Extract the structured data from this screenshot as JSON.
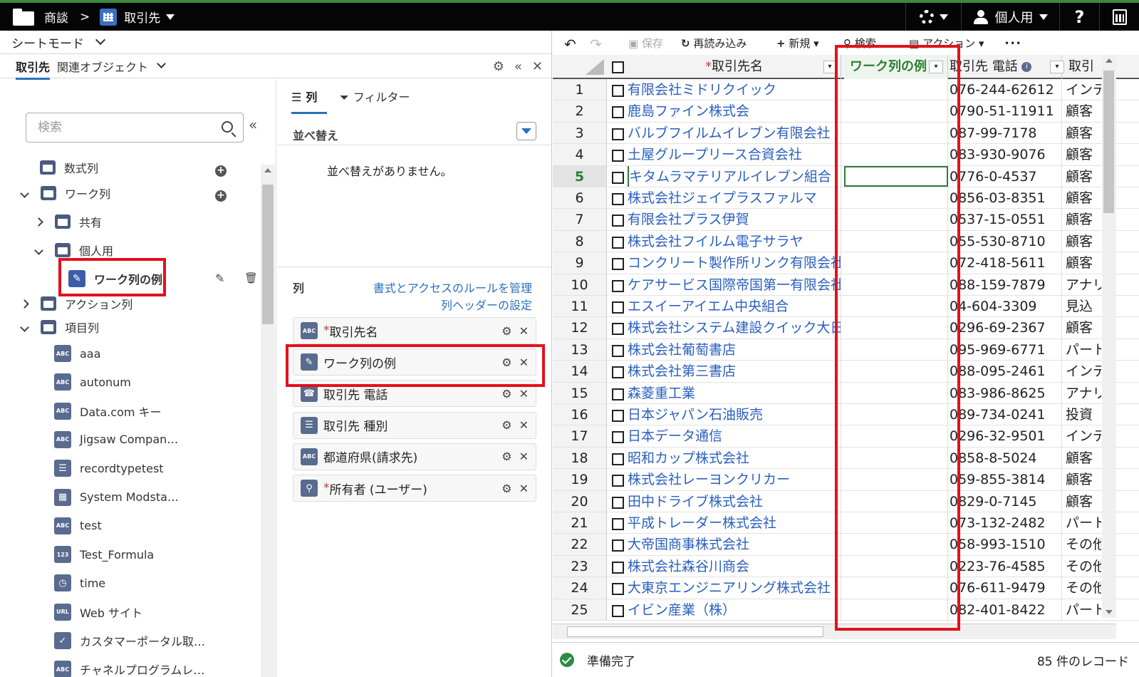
{
  "topbar": {
    "breadcrumb_parent": "商談",
    "separator": ">",
    "current": "取引先",
    "user_view": "個人用",
    "help": "?"
  },
  "left": {
    "sheet_mode": "シートモード",
    "tab_active": "取引先",
    "tab_related": "関連オブジェクト",
    "search_placeholder": "検索",
    "tree": [
      {
        "label": "数式列"
      },
      {
        "label": "ワーク列"
      },
      {
        "label": "共有"
      },
      {
        "label": "個人用"
      },
      {
        "label": "ワーク列の例"
      },
      {
        "label": "アクション列"
      },
      {
        "label": "項目列"
      }
    ],
    "fields": [
      {
        "label": "aaa",
        "icon": "ABC"
      },
      {
        "label": "autonum",
        "icon": "ABC"
      },
      {
        "label": "Data.com キー",
        "icon": "ABC"
      },
      {
        "label": "Jigsaw Compan…",
        "icon": "ABC"
      },
      {
        "label": "recordtypetest",
        "icon": "☰"
      },
      {
        "label": "System Modsta…",
        "icon": "▦"
      },
      {
        "label": "test",
        "icon": "ABC"
      },
      {
        "label": "Test_Formula",
        "icon": "123"
      },
      {
        "label": "time",
        "icon": "◷"
      },
      {
        "label": "Web サイト",
        "icon": "URL"
      },
      {
        "label": "カスタマーポータル取…",
        "icon": "✓"
      },
      {
        "label": "チャネルプログラムレ…",
        "icon": "ABC"
      }
    ]
  },
  "middle": {
    "tab_columns": "列",
    "tab_filter": "フィルター",
    "sort_title": "並べ替え",
    "sort_empty": "並べ替えがありません。",
    "columns_title": "列",
    "link_rules": "書式とアクセスのルールを管理",
    "link_header": "列ヘッダーの設定",
    "columns": [
      {
        "label": "取引先名",
        "required": "*",
        "icon": "ABC"
      },
      {
        "label": "ワーク列の例",
        "required": "",
        "icon": "✎"
      },
      {
        "label": "取引先 電話",
        "required": "",
        "icon": "☎"
      },
      {
        "label": "取引先 種別",
        "required": "",
        "icon": "☰"
      },
      {
        "label": "都道府県(請求先)",
        "required": "",
        "icon": "ABC"
      },
      {
        "label": "所有者 (ユーザー)",
        "required": "*",
        "icon": "⚲"
      }
    ]
  },
  "toolbar": {
    "save": "保存",
    "reload": "再読み込み",
    "new": "新規",
    "search": "検索",
    "action": "アクション",
    "more": "•••"
  },
  "grid": {
    "headers": {
      "name": "取引先名",
      "name_req": "*",
      "work": "ワーク列の例",
      "phone": "取引先 電話",
      "type": "取引"
    },
    "selected_row": 5,
    "rows": [
      {
        "n": "1",
        "name": "有限会社ミドリクイック",
        "phone": "076-244-62612",
        "type": "インテ"
      },
      {
        "n": "2",
        "name": "鹿島ファイン株式会",
        "phone": "0790-51-11911",
        "type": "顧客"
      },
      {
        "n": "3",
        "name": "バルブフイルムイレブン有限会社",
        "phone": "087-99-7178",
        "type": "顧客"
      },
      {
        "n": "4",
        "name": "土屋グループリース合資会社",
        "phone": "083-930-9076",
        "type": "顧客"
      },
      {
        "n": "5",
        "name": "キタムラマテリアルイレブン組合",
        "phone": "0776-0-4537",
        "type": "顧客"
      },
      {
        "n": "6",
        "name": "株式会社ジェイプラスファルマ",
        "phone": "0856-03-8351",
        "type": "顧客"
      },
      {
        "n": "7",
        "name": "有限会社プラス伊賀",
        "phone": "0537-15-0551",
        "type": "顧客"
      },
      {
        "n": "8",
        "name": "株式会社フイルム電子サラヤ",
        "phone": "055-530-8710",
        "type": "顧客"
      },
      {
        "n": "9",
        "name": "コンクリート製作所リンク有限会社",
        "phone": "072-418-5611",
        "type": "顧客"
      },
      {
        "n": "10",
        "name": "ケアサービス国際帝国第一有限会社",
        "phone": "088-159-7879",
        "type": "アナリ"
      },
      {
        "n": "11",
        "name": "エスイーアイエム中央組合",
        "phone": "04-604-3309",
        "type": "見込"
      },
      {
        "n": "12",
        "name": "株式会社システム建設クイック大日本",
        "phone": "0296-69-2367",
        "type": "顧客"
      },
      {
        "n": "13",
        "name": "株式会社葡萄書店",
        "phone": "095-969-6771",
        "type": "パート"
      },
      {
        "n": "14",
        "name": "株式会社第三書店",
        "phone": "088-095-2461",
        "type": "インテ"
      },
      {
        "n": "15",
        "name": "森菱重工業",
        "phone": "083-986-8625",
        "type": "アナリ"
      },
      {
        "n": "16",
        "name": "日本ジャパン石油販売",
        "phone": "089-734-0241",
        "type": "投資"
      },
      {
        "n": "17",
        "name": "日本データ通信",
        "phone": "0296-32-9501",
        "type": "インテ"
      },
      {
        "n": "18",
        "name": "昭和カップ株式会社",
        "phone": "0858-8-5024",
        "type": "顧客"
      },
      {
        "n": "19",
        "name": "株式会社レーヨンクリカー",
        "phone": "059-855-3814",
        "type": "顧客"
      },
      {
        "n": "20",
        "name": "田中ドライブ株式会社",
        "phone": "0829-0-7145",
        "type": "顧客"
      },
      {
        "n": "21",
        "name": "平成トレーダー株式会社",
        "phone": "073-132-2482",
        "type": "パート"
      },
      {
        "n": "22",
        "name": "大帝国商事株式会社",
        "phone": "058-993-1510",
        "type": "その他"
      },
      {
        "n": "23",
        "name": "株式会社森谷川商会",
        "phone": "0223-76-4585",
        "type": "その他"
      },
      {
        "n": "24",
        "name": "大東京エンジニアリング株式会社",
        "phone": "076-611-9479",
        "type": "その他"
      },
      {
        "n": "25",
        "name": "イビン産業（株）",
        "phone": "082-401-8422",
        "type": "パート"
      }
    ]
  },
  "status": {
    "ready": "準備完了",
    "count": "85 件のレコード"
  },
  "colors": {
    "highlight": "#e3101c",
    "link": "#2a5fbd",
    "selected": "#3a8a3e"
  }
}
